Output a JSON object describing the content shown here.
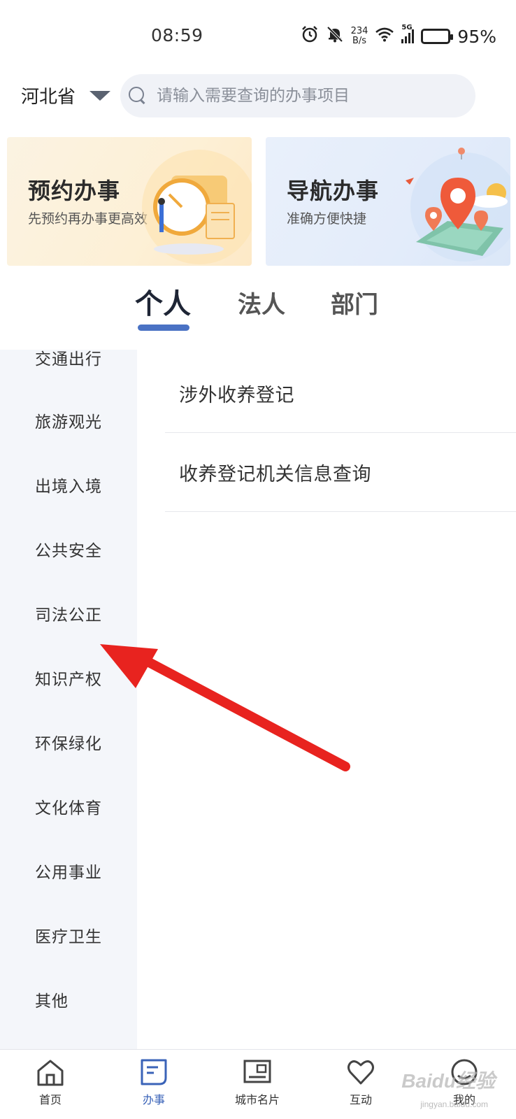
{
  "status_bar": {
    "time": "08:59",
    "net_speed_value": "234",
    "net_speed_unit": "B/s",
    "network": "5G",
    "battery": "95%"
  },
  "header": {
    "province": "河北省",
    "search_placeholder": "请输入需要查询的办事项目"
  },
  "banners": [
    {
      "title": "预约办事",
      "subtitle": "先预约再办事更高效"
    },
    {
      "title": "导航办事",
      "subtitle": "准确方便快捷"
    }
  ],
  "tabs": [
    {
      "label": "个人",
      "active": true
    },
    {
      "label": "法人",
      "active": false
    },
    {
      "label": "部门",
      "active": false
    }
  ],
  "categories": [
    "交通出行",
    "旅游观光",
    "出境入境",
    "公共安全",
    "司法公正",
    "知识产权",
    "环保绿化",
    "文化体育",
    "公用事业",
    "医疗卫生",
    "其他"
  ],
  "items": [
    "涉外收养登记",
    "收养登记机关信息查询"
  ],
  "bottom_nav": [
    {
      "label": "首页",
      "icon": "home-icon"
    },
    {
      "label": "办事",
      "icon": "service-icon",
      "active": true
    },
    {
      "label": "城市名片",
      "icon": "city-card-icon"
    },
    {
      "label": "互动",
      "icon": "heart-icon"
    },
    {
      "label": "我的",
      "icon": "profile-icon"
    }
  ],
  "watermark": {
    "main": "Baidu经验",
    "sub": "jingyan.baidu.com"
  },
  "colors": {
    "accent": "#4a72c4",
    "annotation_arrow": "#e8231f",
    "category_bg": "#f4f6fa"
  }
}
